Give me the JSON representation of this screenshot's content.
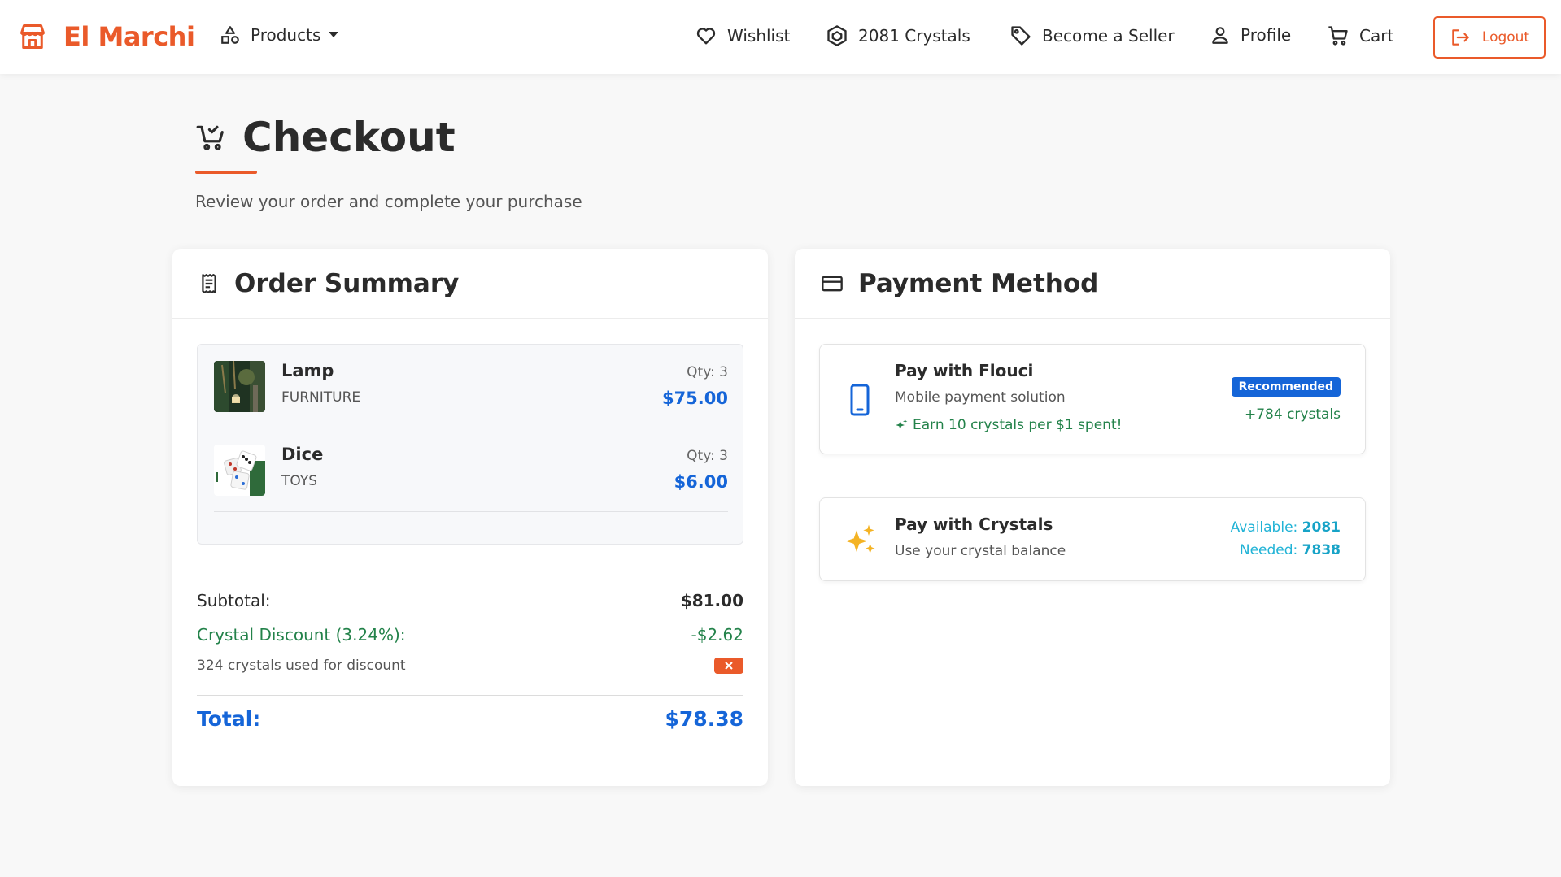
{
  "brand": {
    "name": "El Marchi",
    "color": "#ea5a2a"
  },
  "nav": {
    "products": "Products",
    "wishlist": "Wishlist",
    "crystals": "2081 Crystals",
    "become_seller": "Become a Seller",
    "profile": "Profile",
    "cart": "Cart",
    "logout": "Logout"
  },
  "header": {
    "title": "Checkout",
    "subtitle": "Review your order and complete your purchase"
  },
  "order_summary": {
    "title": "Order Summary",
    "items": [
      {
        "name": "Lamp",
        "category": "FURNITURE",
        "qty": "Qty: 3",
        "price": "$75.00"
      },
      {
        "name": "Dice",
        "category": "TOYS",
        "qty": "Qty: 3",
        "price": "$6.00"
      }
    ],
    "subtotal_label": "Subtotal:",
    "subtotal_value": "$81.00",
    "discount_label": "Crystal Discount (3.24%):",
    "discount_value": "-$2.62",
    "crystals_used": "324 crystals used for discount",
    "total_label": "Total:",
    "total_value": "$78.38"
  },
  "payment": {
    "title": "Payment Method",
    "flouci": {
      "name": "Pay with Flouci",
      "desc": "Mobile payment solution",
      "earn": "Earn 10 crystals per $1 spent!",
      "badge": "Recommended",
      "bonus": "+784 crystals"
    },
    "crystals": {
      "name": "Pay with Crystals",
      "desc": "Use your crystal balance",
      "available_label": "Available: ",
      "available_value": "2081",
      "needed_label": "Needed: ",
      "needed_value": "7838"
    }
  },
  "colors": {
    "accent": "#ea5a2a",
    "primary_blue": "#1565d8",
    "success_green": "#23824a",
    "crystal_cyan": "#21b3d6",
    "sparkle_yellow": "#f4b324"
  },
  "icons": {
    "brand": "store-icon",
    "products": "shapes-icon",
    "wishlist": "heart-icon",
    "crystals": "gem-icon",
    "seller": "tag-icon",
    "profile": "user-icon",
    "cart": "cart-icon",
    "logout": "logout-icon",
    "checkout": "cart-check-icon",
    "order_summary": "receipt-icon",
    "payment": "credit-card-icon",
    "flouci": "phone-icon",
    "crystals_pay": "sparkles-icon",
    "remove": "close-icon"
  }
}
